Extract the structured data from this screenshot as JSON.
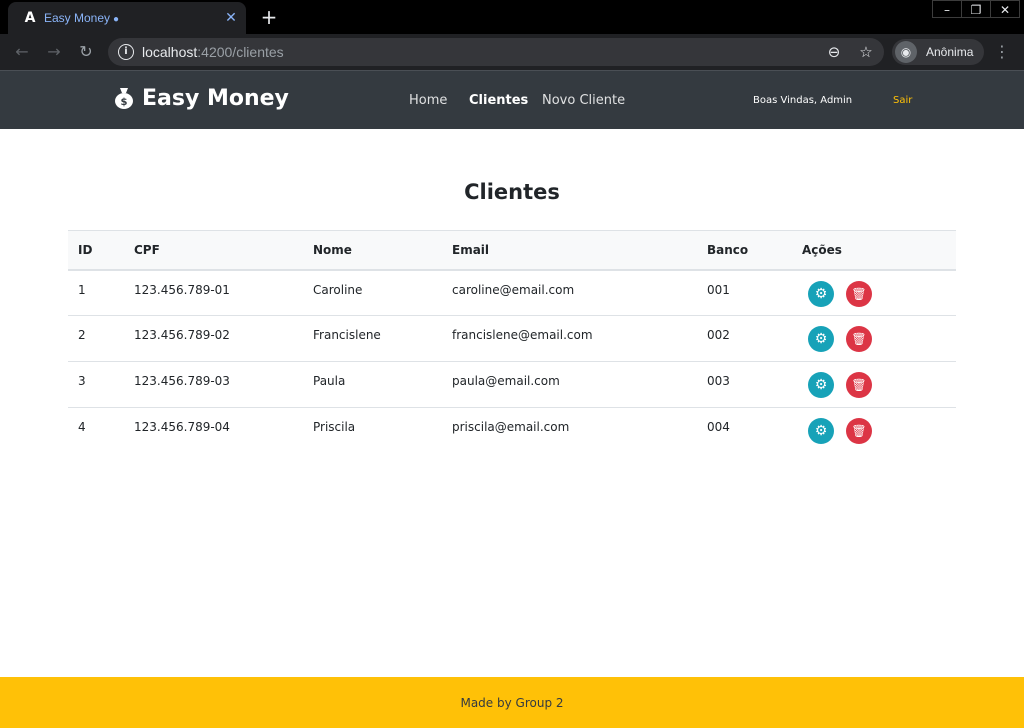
{
  "browser": {
    "tab": {
      "title": "Easy Money",
      "favicon": "angular-icon",
      "title_icon": "money-bag-icon",
      "close": "✕"
    },
    "new_tab": "+",
    "window_controls": [
      "–",
      "❐",
      "✕"
    ],
    "url_host": "localhost",
    "url_path": ":4200/clientes",
    "profile_label": "Anônima"
  },
  "app": {
    "brand": "Easy Money",
    "brand_icon": "money-bag-icon",
    "nav": [
      {
        "label": "Home",
        "active": false
      },
      {
        "label": "Clientes",
        "active": true
      },
      {
        "label": "Novo Cliente",
        "active": false
      }
    ],
    "welcome": "Boas Vindas, Admin",
    "logout": "Sair"
  },
  "main": {
    "title": "Clientes",
    "columns": [
      "ID",
      "CPF",
      "Nome",
      "Email",
      "Banco",
      "Ações"
    ],
    "rows": [
      {
        "id": "1",
        "cpf": "123.456.789-01",
        "nome": "Caroline",
        "email": "caroline@email.com",
        "banco": "001"
      },
      {
        "id": "2",
        "cpf": "123.456.789-02",
        "nome": "Francislene",
        "email": "francislene@email.com",
        "banco": "002"
      },
      {
        "id": "3",
        "cpf": "123.456.789-03",
        "nome": "Paula",
        "email": "paula@email.com",
        "banco": "003"
      },
      {
        "id": "4",
        "cpf": "123.456.789-04",
        "nome": "Priscila",
        "email": "priscila@email.com",
        "banco": "004"
      }
    ]
  },
  "footer": {
    "text": "Made by Group 2"
  },
  "colors": {
    "navbar": "#343a40",
    "footer": "#ffc107",
    "edit": "#17a2b8",
    "delete": "#dc3545",
    "logout": "#ffc107"
  }
}
